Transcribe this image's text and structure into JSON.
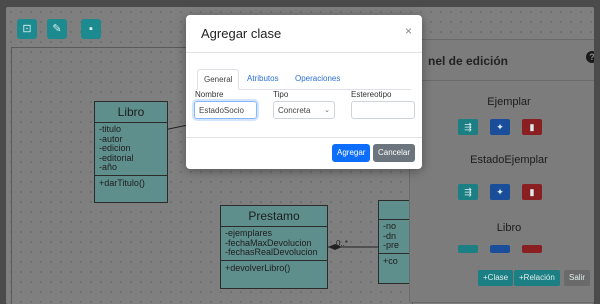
{
  "toolbar": {
    "tool1_icon": "select-icon",
    "tool2_icon": "pencil-icon",
    "tool3_icon": "save-icon"
  },
  "diagram": {
    "libro": {
      "name": "Libro",
      "attributes": [
        "-titulo",
        "-autor",
        "-edicion",
        "-editorial",
        "-año"
      ],
      "operations": [
        "+darTitulo()"
      ]
    },
    "prestamo": {
      "name": "Prestamo",
      "attributes": [
        "-ejemplares",
        "-fechaMaxDevolucion",
        "-fechasRealDevolucion"
      ],
      "operations": [
        "+devolverLibro()"
      ]
    },
    "partial_class": {
      "attributes": [
        "-no",
        "-dn",
        "-pre"
      ],
      "operations": [
        "+co"
      ]
    },
    "multiplicity": "0..*"
  },
  "side_panel": {
    "title": "nel de edición",
    "items": [
      "Ejemplar",
      "EstadoEjemplar",
      "Libro"
    ],
    "footer": {
      "add_class": "+Clase",
      "add_relation": "+Relación",
      "exit": "Salir"
    }
  },
  "modal": {
    "title": "Agregar clase",
    "close": "×",
    "tabs": [
      "General",
      "Atributos",
      "Operaciones"
    ],
    "name_label": "Nombre",
    "name_value": "EstadoSocio",
    "type_label": "Tipo",
    "type_value": "Concreta",
    "stereotype_label": "Estereotipo",
    "stereotype_value": "",
    "add_button": "Agregar",
    "cancel_button": "Cancelar"
  },
  "colors": {
    "accent": "#1c8a8f",
    "primary": "#0d6efd",
    "danger": "#8a1f22"
  }
}
